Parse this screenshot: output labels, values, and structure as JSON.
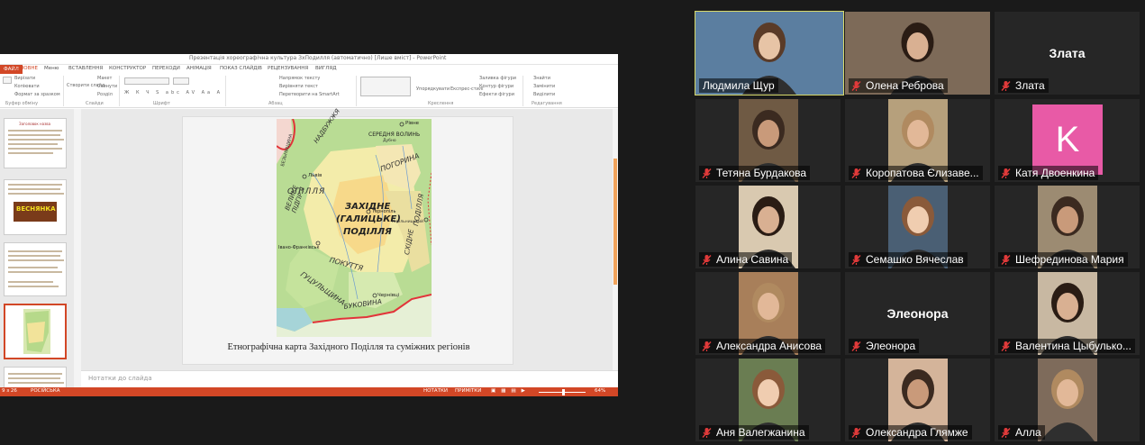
{
  "powerpoint": {
    "window_title": "Презентація хореографічна культура ЗхПодилля (автоматично) [Лише вміст] - PowerPoint",
    "tabs": [
      "ФАЙЛ",
      "ОСНОВНЕ",
      "Меню",
      "ВСТАВЛЕННЯ",
      "КОНСТРУКТОР",
      "ПЕРЕХОДИ",
      "АНІМАЦІЯ",
      "ПОКАЗ СЛАЙДІВ",
      "РЕЦЕНЗУВАННЯ",
      "ВИГЛЯД"
    ],
    "ribbon": {
      "clipboard": [
        "Вирізати",
        "Копіювати",
        "Формат за зразком"
      ],
      "clipboard_group": "Буфер обміну",
      "slides": [
        "Створити слайд",
        "Макет",
        "Скинути",
        "Розділ"
      ],
      "slides_group": "Слайди",
      "font_group": "Шрифт",
      "paragraph": [
        "Напрямок тексту",
        "Вирівняти текст",
        "Перетворити на SmartArt"
      ],
      "paragraph_group": "Абзац",
      "arrange": "Упорядкувати",
      "quick_styles": "Експрес-стилі",
      "drawing": [
        "Заливка фігури",
        "Контур фігури",
        "Ефекти фігури"
      ],
      "drawing_group": "Креслення",
      "editing": [
        "Знайти",
        "Замінити",
        "Виділити"
      ],
      "editing_group": "Редагування"
    },
    "thumb_title": "Заголовок назва",
    "thumb_banner": "ВЕСНЯНКА",
    "slide_caption": "Етнографічна карта Західного Поділля та суміжних регіонів",
    "notes_placeholder": "Нотатки до слайда",
    "status": {
      "slide_info": "9 з 26",
      "language": "РОСІЙСЬКА",
      "notes_btn": "НОТАТКИ",
      "comments_btn": "ПРИМІТКИ",
      "zoom": "64%"
    }
  },
  "map_labels": {
    "rivne": "Рівне",
    "nadbuzhzhia": "НАДБУЖЖЯ",
    "serednie_volyn": "СЕРЕДНЯ ВОЛИНЬ",
    "dubno": "Дубно",
    "lviv": "Львів",
    "opillia": "ОПІЛЛЯ",
    "pohoryna": "ПОГОРИНА",
    "zakhidne_podillia": "ЗАХІДНЕ",
    "zakhidne_podillia2": "(ГАЛИЦЬКЕ)",
    "zakhidne_podillia3": "ПОДІЛЛЯ",
    "ternopil": "Тернопіль",
    "skhidne": "СХІДНЕ",
    "podillia": "ПОДІЛЛЯ",
    "velyke_pidillia": "ВЕЛИКЕ ПІДГІР'Я",
    "ivano_frankivsk": "Івано-Франківськ",
    "pokuttia": "ПОКУТТЯ",
    "khmelnytskyi": "Хмельницький",
    "hutsulshchyna": "ГУЦУЛЬЩИНА",
    "chernivtsi": "Чернівці",
    "bukovyna": "БУКОВИНА",
    "bezhnyshchyna": "БЕЗЬНИЩИНА"
  },
  "participants": [
    {
      "name": "Людмила Щур",
      "type": "video",
      "active": true
    },
    {
      "name": "Олена Реброва",
      "type": "video"
    },
    {
      "name": "Злата",
      "type": "name",
      "big_name": "Злата"
    },
    {
      "name": "Тетяна Бурдакова",
      "type": "video"
    },
    {
      "name": "Коропатова Єлизаве...",
      "type": "video"
    },
    {
      "name": "Катя Двоенкина",
      "type": "avatar",
      "avatar_letter": "K"
    },
    {
      "name": "Алина Савина",
      "type": "video"
    },
    {
      "name": "Семашко Вячеслав",
      "type": "video"
    },
    {
      "name": "Шефрединова Мария",
      "type": "video"
    },
    {
      "name": "Александра Анисова",
      "type": "video"
    },
    {
      "name": "Элеонора",
      "type": "name",
      "big_name": "Элеонора"
    },
    {
      "name": "Валентина Цыбулько...",
      "type": "video"
    },
    {
      "name": "Аня Валегжанина",
      "type": "video"
    },
    {
      "name": "Олександра Глямже",
      "type": "video"
    },
    {
      "name": "Алла",
      "type": "video"
    }
  ],
  "colors": {
    "powerpoint_accent": "#d24726",
    "active_speaker": "#d7d96a",
    "muted_icon": "#e03a3a",
    "avatar_bg": "#e85aa6"
  }
}
